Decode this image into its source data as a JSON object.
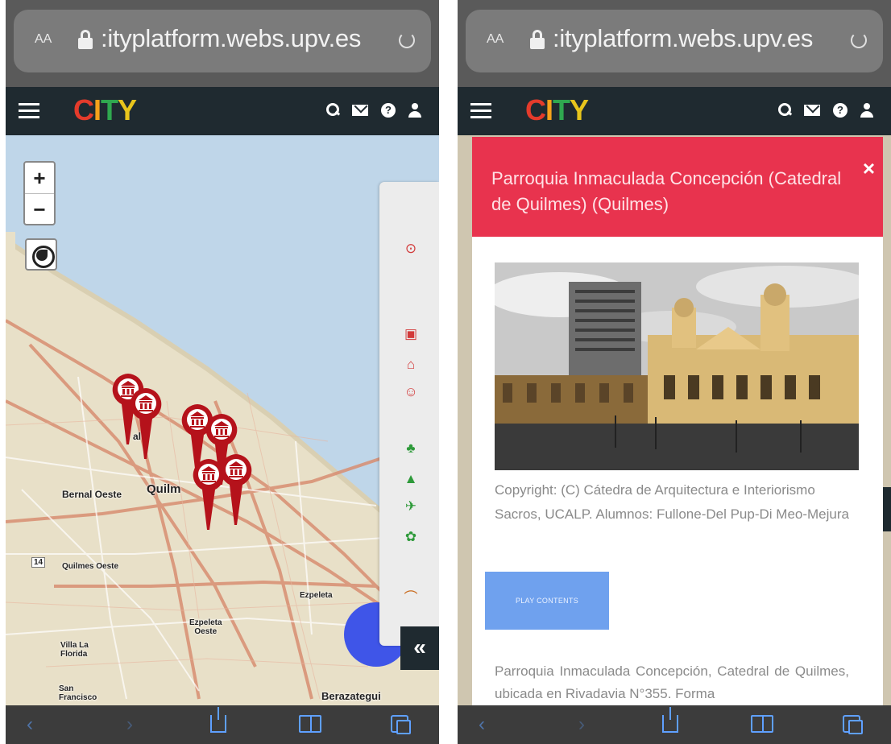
{
  "browser": {
    "aa_label": "AA",
    "url": ":ityplatform.webs.upv.es"
  },
  "app": {
    "logo": "CITY",
    "nav_icons": [
      "search-icon",
      "mail-icon",
      "help-icon",
      "user-icon"
    ]
  },
  "map": {
    "zoom_in": "+",
    "zoom_out": "−",
    "labels": {
      "bernal_oeste": "Bernal Oeste",
      "quilmes": "Quilm",
      "quilmes_oeste": "Quilmes Oeste",
      "bernal": "al",
      "ezpeleta": "Ezpeleta",
      "ezpeleta_oeste": "Ezpeleta\nOeste",
      "villa_la_florida": "Villa La\nFlorida",
      "san_francisco": "San\nFrancisco",
      "berazategui": "Berazategui",
      "route_14": "14"
    },
    "layer_icons": [
      "location-pin-icon",
      "book-icon",
      "museum-icon",
      "theater-icon",
      "tree-icon",
      "mountain-icon",
      "bird-icon",
      "plant-icon",
      "bridge-icon"
    ],
    "collapse_label": "«",
    "pin_color": "#b5121b"
  },
  "modal": {
    "title": "Parroquia Inmaculada Concepción (Catedral de Quilmes) (Quilmes)",
    "close_label": "×",
    "copyright": "Copyright: (C) Cátedra de Arquitectura e Interiorismo Sacros, UCALP. Alumnos: Fullone-Del Pup-Di Meo-Mejura",
    "play_button": "PLAY CONTENTS",
    "description": "Parroquia Inmaculada Concepción, Catedral de Quilmes, ubicada en Rivadavia N°355. Forma",
    "header_color": "#e8334e",
    "button_color": "#6fa1ee"
  },
  "toolbar": {
    "back": "‹",
    "forward": "›"
  }
}
